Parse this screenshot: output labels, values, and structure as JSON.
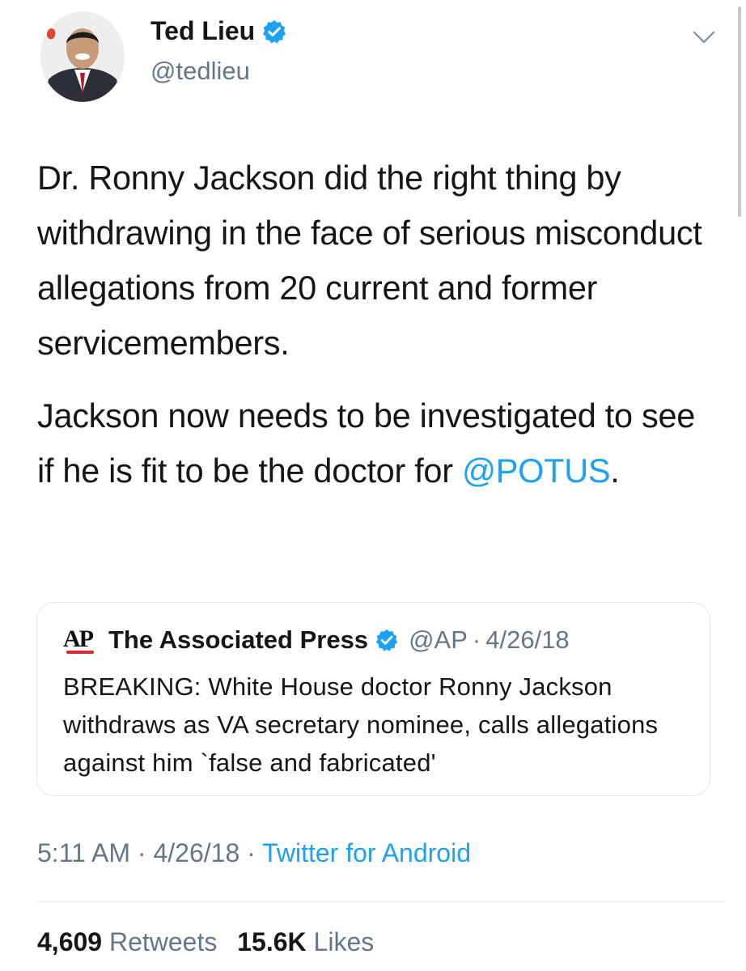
{
  "author": {
    "name": "Ted Lieu",
    "handle": "@tedlieu",
    "avatar_icon": "profile-photo",
    "verified_icon": "verified-badge-icon"
  },
  "tweet": {
    "paragraph_1": "Dr. Ronny Jackson did the right thing by withdrawing in the face of serious misconduct allegations from 20 current and former servicemembers.",
    "paragraph_2_prefix": "Jackson now needs to be investigated to see if he is fit to be the doctor for ",
    "mention": "@POTUS",
    "paragraph_2_suffix": "."
  },
  "quoted_tweet": {
    "logo_text": "AP",
    "name": "The Associated Press",
    "handle": "@AP",
    "separator": "·",
    "date": "4/26/18",
    "text": "BREAKING: White House doctor Ronny Jackson withdraws as VA secretary nominee, calls allegations against him `false and fabricated'"
  },
  "meta": {
    "time": "5:11 AM",
    "separator": "·",
    "date": "4/26/18",
    "source": "Twitter for Android"
  },
  "stats": {
    "retweets_count": "4,609",
    "retweets_label": "Retweets",
    "likes_count": "15.6K",
    "likes_label": "Likes"
  },
  "colors": {
    "link": "#1da1f2",
    "secondary_text": "#657786",
    "verified": "#1da1f2",
    "ap_red": "#e0262f"
  }
}
